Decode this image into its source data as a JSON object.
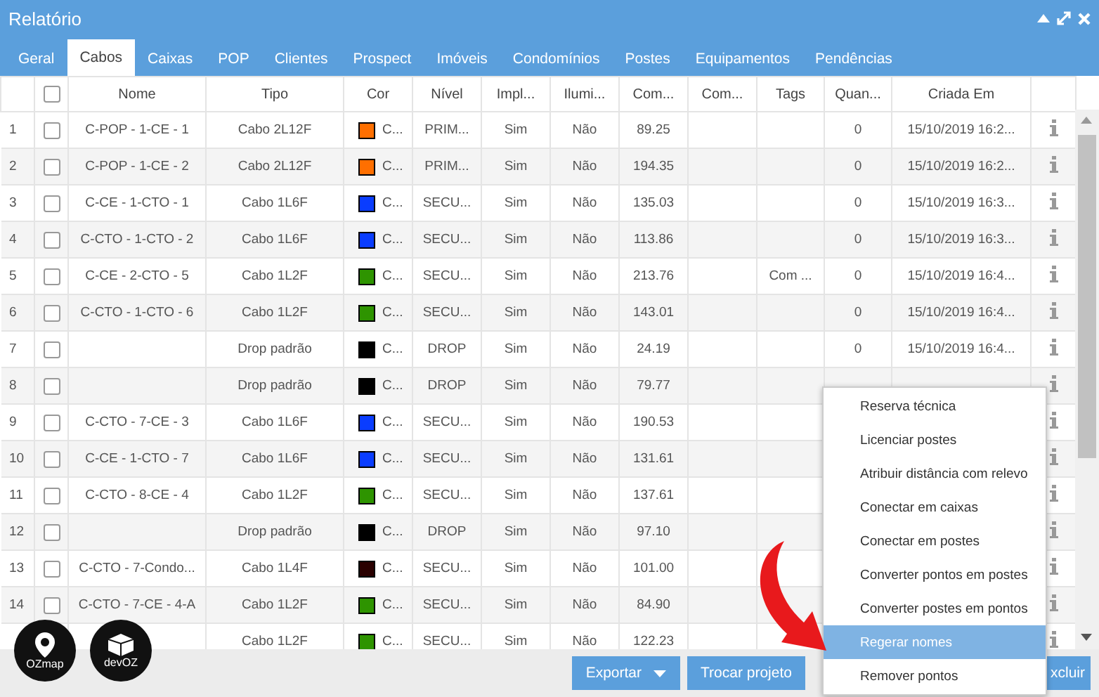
{
  "window": {
    "title": "Relatório"
  },
  "tabs": [
    {
      "label": "Geral",
      "selected": false
    },
    {
      "label": "Cabos",
      "selected": true
    },
    {
      "label": "Caixas",
      "selected": false
    },
    {
      "label": "POP",
      "selected": false
    },
    {
      "label": "Clientes",
      "selected": false
    },
    {
      "label": "Prospect",
      "selected": false
    },
    {
      "label": "Imóveis",
      "selected": false
    },
    {
      "label": "Condomínios",
      "selected": false
    },
    {
      "label": "Postes",
      "selected": false
    },
    {
      "label": "Equipamentos",
      "selected": false
    },
    {
      "label": "Pendências",
      "selected": false
    }
  ],
  "table": {
    "header_checked": false,
    "columns": [
      "Nome",
      "Tipo",
      "Cor",
      "Nível",
      "Impl...",
      "Ilumi...",
      "Com...",
      "Com...",
      "Tags",
      "Quan...",
      "Criada Em"
    ],
    "rows": [
      {
        "num": "1",
        "checked": false,
        "nome": "C-POP - 1-CE - 1",
        "tipo": "Cabo 2L12F",
        "color": "#ff6f00",
        "cor": "C...",
        "nivel": "PRIM...",
        "impl": "Sim",
        "ilum": "Não",
        "comp": "89.25",
        "tags": "",
        "quan": "0",
        "criada": "15/10/2019 16:2..."
      },
      {
        "num": "2",
        "checked": false,
        "nome": "C-POP - 1-CE - 2",
        "tipo": "Cabo 2L12F",
        "color": "#ff6f00",
        "cor": "C...",
        "nivel": "PRIM...",
        "impl": "Sim",
        "ilum": "Não",
        "comp": "194.35",
        "tags": "",
        "quan": "0",
        "criada": "15/10/2019 16:2..."
      },
      {
        "num": "3",
        "checked": false,
        "nome": "C-CE - 1-CTO - 1",
        "tipo": "Cabo 1L6F",
        "color": "#0a3dff",
        "cor": "C...",
        "nivel": "SECU...",
        "impl": "Sim",
        "ilum": "Não",
        "comp": "135.03",
        "tags": "",
        "quan": "0",
        "criada": "15/10/2019 16:3..."
      },
      {
        "num": "4",
        "checked": false,
        "nome": "C-CTO - 1-CTO - 2",
        "tipo": "Cabo 1L6F",
        "color": "#0a3dff",
        "cor": "C...",
        "nivel": "SECU...",
        "impl": "Sim",
        "ilum": "Não",
        "comp": "113.86",
        "tags": "",
        "quan": "0",
        "criada": "15/10/2019 16:3..."
      },
      {
        "num": "5",
        "checked": false,
        "nome": "C-CE - 2-CTO - 5",
        "tipo": "Cabo 1L2F",
        "color": "#2e9400",
        "cor": "C...",
        "nivel": "SECU...",
        "impl": "Sim",
        "ilum": "Não",
        "comp": "213.76",
        "tags": "Com ...",
        "quan": "0",
        "criada": "15/10/2019 16:4..."
      },
      {
        "num": "6",
        "checked": false,
        "nome": "C-CTO - 1-CTO - 6",
        "tipo": "Cabo 1L2F",
        "color": "#2e9400",
        "cor": "C...",
        "nivel": "SECU...",
        "impl": "Sim",
        "ilum": "Não",
        "comp": "143.01",
        "tags": "",
        "quan": "0",
        "criada": "15/10/2019 16:4..."
      },
      {
        "num": "7",
        "checked": false,
        "nome": "",
        "tipo": "Drop padrão",
        "color": "#000000",
        "cor": "C...",
        "nivel": "DROP",
        "impl": "Sim",
        "ilum": "Não",
        "comp": "24.19",
        "tags": "",
        "quan": "0",
        "criada": "15/10/2019 16:4..."
      },
      {
        "num": "8",
        "checked": false,
        "nome": "",
        "tipo": "Drop padrão",
        "color": "#000000",
        "cor": "C...",
        "nivel": "DROP",
        "impl": "Sim",
        "ilum": "Não",
        "comp": "79.77",
        "tags": "",
        "quan": "",
        "criada": ""
      },
      {
        "num": "9",
        "checked": false,
        "nome": "C-CTO - 7-CE - 3",
        "tipo": "Cabo 1L6F",
        "color": "#0a3dff",
        "cor": "C...",
        "nivel": "SECU...",
        "impl": "Sim",
        "ilum": "Não",
        "comp": "190.53",
        "tags": "",
        "quan": "",
        "criada": ""
      },
      {
        "num": "10",
        "checked": false,
        "nome": "C-CE - 1-CTO - 7",
        "tipo": "Cabo 1L6F",
        "color": "#0a3dff",
        "cor": "C...",
        "nivel": "SECU...",
        "impl": "Sim",
        "ilum": "Não",
        "comp": "131.61",
        "tags": "",
        "quan": "",
        "criada": ""
      },
      {
        "num": "11",
        "checked": false,
        "nome": "C-CTO - 8-CE - 4",
        "tipo": "Cabo 1L2F",
        "color": "#2e9400",
        "cor": "C...",
        "nivel": "SECU...",
        "impl": "Sim",
        "ilum": "Não",
        "comp": "137.61",
        "tags": "",
        "quan": "",
        "criada": ""
      },
      {
        "num": "12",
        "checked": false,
        "nome": "",
        "tipo": "Drop padrão",
        "color": "#000000",
        "cor": "C...",
        "nivel": "DROP",
        "impl": "Sim",
        "ilum": "Não",
        "comp": "97.10",
        "tags": "",
        "quan": "",
        "criada": ""
      },
      {
        "num": "13",
        "checked": false,
        "nome": "C-CTO - 7-Condo...",
        "tipo": "Cabo 1L4F",
        "color": "#2a0000",
        "cor": "C...",
        "nivel": "SECU...",
        "impl": "Sim",
        "ilum": "Não",
        "comp": "101.00",
        "tags": "",
        "quan": "",
        "criada": ""
      },
      {
        "num": "14",
        "checked": false,
        "nome": "C-CTO - 7-CE - 4-A",
        "tipo": "Cabo 1L2F",
        "color": "#2e9400",
        "cor": "C...",
        "nivel": "SECU...",
        "impl": "Sim",
        "ilum": "Não",
        "comp": "84.90",
        "tags": "",
        "quan": "",
        "criada": ""
      },
      {
        "num": "",
        "nome": "",
        "tipo": "Cabo 1L2F",
        "color": "#2e9400",
        "cor": "C...",
        "nivel": "SECU...",
        "impl": "Sim",
        "ilum": "Não",
        "comp": "122.23",
        "tags": "",
        "quan": "",
        "criada": ""
      }
    ]
  },
  "footer": {
    "buttons": [
      {
        "label": "Exportar",
        "kind": "dropdown"
      },
      {
        "label": "Trocar projeto",
        "kind": "plain"
      }
    ],
    "partial_button": "xcluir"
  },
  "menu": [
    {
      "label": "Reserva técnica",
      "selected": false
    },
    {
      "label": "Licenciar postes",
      "selected": false
    },
    {
      "label": "Atribuir distância com relevo",
      "selected": false
    },
    {
      "label": "Conectar em caixas",
      "selected": false
    },
    {
      "label": "Conectar em postes",
      "selected": false
    },
    {
      "label": "Converter pontos em postes",
      "selected": false
    },
    {
      "label": "Converter postes em pontos",
      "selected": false
    },
    {
      "label": "Regerar nomes",
      "selected": true
    },
    {
      "label": "Remover pontos",
      "selected": false
    }
  ],
  "logos": [
    {
      "kind": "pin",
      "label": "OZmap"
    },
    {
      "kind": "cube",
      "label": "devOZ"
    }
  ]
}
